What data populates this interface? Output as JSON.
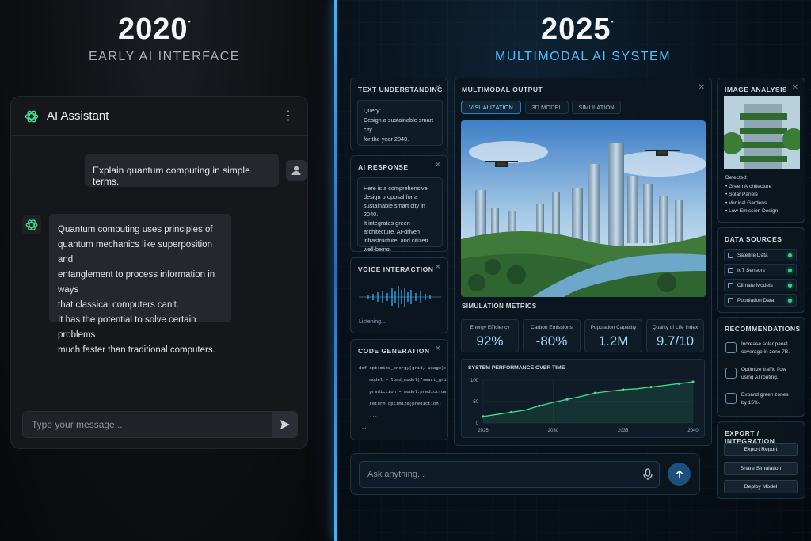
{
  "left": {
    "year": "2020",
    "subtitle": "EARLY AI INTERFACE",
    "chat": {
      "title": "AI Assistant",
      "user_message": "Explain quantum computing in simple terms.",
      "bot_lines": [
        "Quantum computing uses principles of",
        "quantum mechanics like superposition and",
        "entanglement to process information in ways",
        "that classical computers can't.",
        "It has the potential to solve certain problems",
        "much faster than traditional computers."
      ],
      "input_placeholder": "Type your message..."
    }
  },
  "right": {
    "year": "2025",
    "subtitle": "MULTIMODAL AI SYSTEM",
    "text_understanding": {
      "title": "TEXT UNDERSTANDING",
      "query_label": "Query:",
      "query_lines": [
        "Design a sustainable smart city",
        "for the year 2040."
      ]
    },
    "ai_response": {
      "title": "AI RESPONSE",
      "lines": [
        "Here is a comprehensive",
        "design proposal for a",
        "sustainable smart city in 2040.",
        "It integrates green",
        "architecture, AI-driven",
        "infrastructure, and citizen",
        "well-being."
      ]
    },
    "voice": {
      "title": "VOICE INTERACTION",
      "status": "Listening..."
    },
    "code": {
      "title": "CODE GENERATION",
      "lines": [
        "def optimize_energy(grid, usage):",
        "    model = load_model(\"smart_grid\")",
        "    prediction = model.predict(usage)",
        "    return optimize(prediction)",
        "    ...",
        "..."
      ]
    },
    "output": {
      "title": "MULTIMODAL OUTPUT",
      "tabs": [
        "VISUALIZATION",
        "3D MODEL",
        "SIMULATION"
      ],
      "metrics_title": "SIMULATION METRICS",
      "metrics": [
        {
          "label": "Energy Efficiency",
          "value": "92%"
        },
        {
          "label": "Carbon Emissions",
          "value": "-80%"
        },
        {
          "label": "Population Capacity",
          "value": "1.2M"
        },
        {
          "label": "Quality of Life Index",
          "value": "9.7/10"
        }
      ]
    },
    "image_analysis": {
      "title": "IMAGE ANALYSIS",
      "detected_label": "Detected:",
      "items": [
        "• Green Architecture",
        "• Solar Panels",
        "• Vertical Gardens",
        "• Low Emission Design"
      ]
    },
    "data_sources": {
      "title": "DATA SOURCES",
      "items": [
        "Satellite Data",
        "IoT Sensors",
        "Climate Models",
        "Population Data"
      ]
    },
    "recommendations": {
      "title": "RECOMMENDATIONS",
      "items": [
        {
          "l1": "Increase solar panel",
          "l2": "coverage in zone 7B."
        },
        {
          "l1": "Optimize traffic flow",
          "l2": "using AI routing."
        },
        {
          "l1": "Expand green zones",
          "l2": "by 15%."
        }
      ]
    },
    "export": {
      "title": "EXPORT / INTEGRATION",
      "buttons": [
        "Export Report",
        "Share Simulation",
        "Deploy Model"
      ]
    },
    "ask_placeholder": "Ask anything...",
    "colors": {
      "accent": "#3fb8ff",
      "chart_line": "#3ee08f",
      "status_dot": "#35d07f"
    }
  },
  "chart_data": {
    "type": "line",
    "title": "SYSTEM PERFORMANCE OVER TIME",
    "x": [
      2025,
      2026,
      2027,
      2028,
      2029,
      2030,
      2031,
      2032,
      2033,
      2034,
      2035,
      2036,
      2037,
      2038,
      2039,
      2040
    ],
    "series": [
      {
        "values": [
          15,
          20,
          25,
          30,
          40,
          48,
          55,
          62,
          70,
          74,
          78,
          80,
          84,
          88,
          92,
          96
        ]
      }
    ],
    "xticks": [
      "2025",
      "2030",
      "2035",
      "2040"
    ],
    "yticks": [
      "0",
      "50",
      "100"
    ],
    "xlim": [
      2025,
      2040
    ],
    "ylim": [
      0,
      100
    ],
    "grid": true
  }
}
